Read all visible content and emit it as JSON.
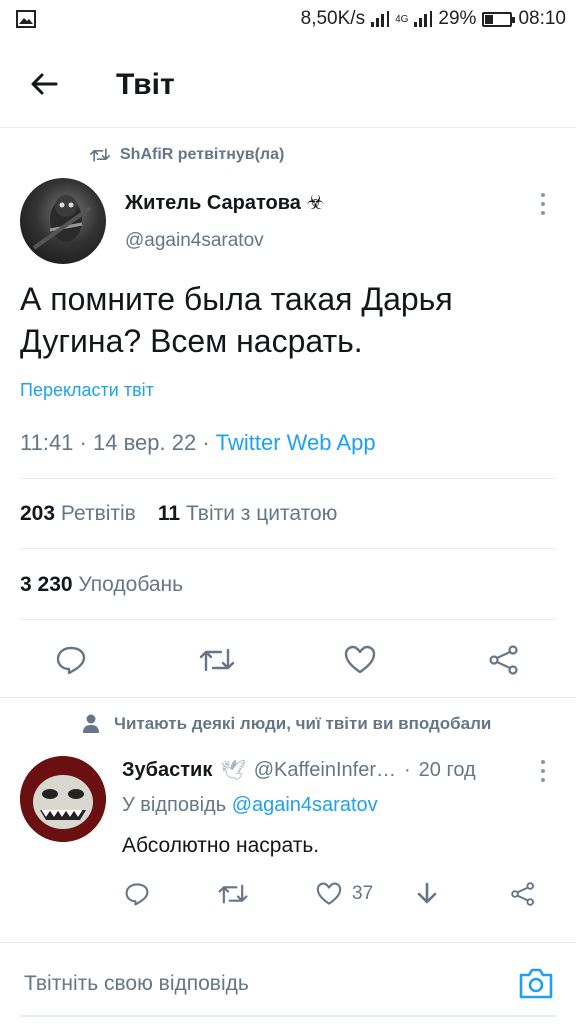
{
  "status_bar": {
    "net_speed": "8,50K/s",
    "net_type": "4G",
    "battery": "29%",
    "battery_level": 0.29,
    "time": "08:10"
  },
  "header": {
    "back_icon": "arrow-left-icon",
    "title": "Твіт"
  },
  "tweet": {
    "retweeted_by": "ShAfiR ретвітнув(ла)",
    "author_name": "Житель Саратова",
    "author_badge_icon": "biohazard-icon",
    "badge_glyph": "☣",
    "author_handle": "@again4saratov",
    "text": "А помните была такая Дарья Дугина? Всем насрать.",
    "translate": "Перекласти твіт",
    "time": "11:41",
    "date": "14 вер. 22",
    "source": "Twitter Web App",
    "sep": "·",
    "retweets_count": "203",
    "retweets_label": "Ретвітів",
    "quotes_count": "11",
    "quotes_label": "Твіти з цитатою",
    "likes_count": "3 230",
    "likes_label": "Уподобань"
  },
  "reply": {
    "context": "Читають деякі люди, чиї твіти ви вподобали",
    "author_name": "Зубастик",
    "author_emoji": "🕊",
    "author_handle": "@KaffeinInfer…",
    "time": "20 год",
    "sep": "·",
    "reply_to_label": "У відповідь",
    "reply_to_handle": "@again4saratov",
    "text": "Абсолютно насрать.",
    "likes": "37"
  },
  "composer": {
    "placeholder": "Твітніть свою відповідь"
  },
  "colors": {
    "accent": "#1da1f2",
    "muted": "#657786",
    "text": "#14171a",
    "divider": "#e6ecf0"
  }
}
